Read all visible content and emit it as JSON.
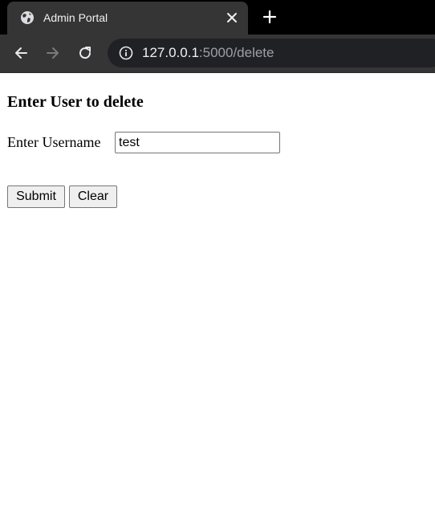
{
  "browser": {
    "tab": {
      "title": "Admin Portal",
      "favicon": "globe-icon"
    },
    "address_bar": {
      "host": "127.0.0.1",
      "path": ":5000/delete"
    },
    "icons": {
      "close": "close-icon",
      "new_tab": "plus-icon",
      "back": "back-arrow-icon",
      "forward": "forward-arrow-icon",
      "reload": "reload-icon",
      "site_info": "info-icon"
    },
    "colors": {
      "tab_strip": "#000000",
      "toolbar": "#353535",
      "omnibox": "#202124"
    }
  },
  "page": {
    "heading": "Enter User to delete",
    "username_label": "Enter Username",
    "username_value": "test",
    "submit_label": "Submit",
    "clear_label": "Clear"
  }
}
